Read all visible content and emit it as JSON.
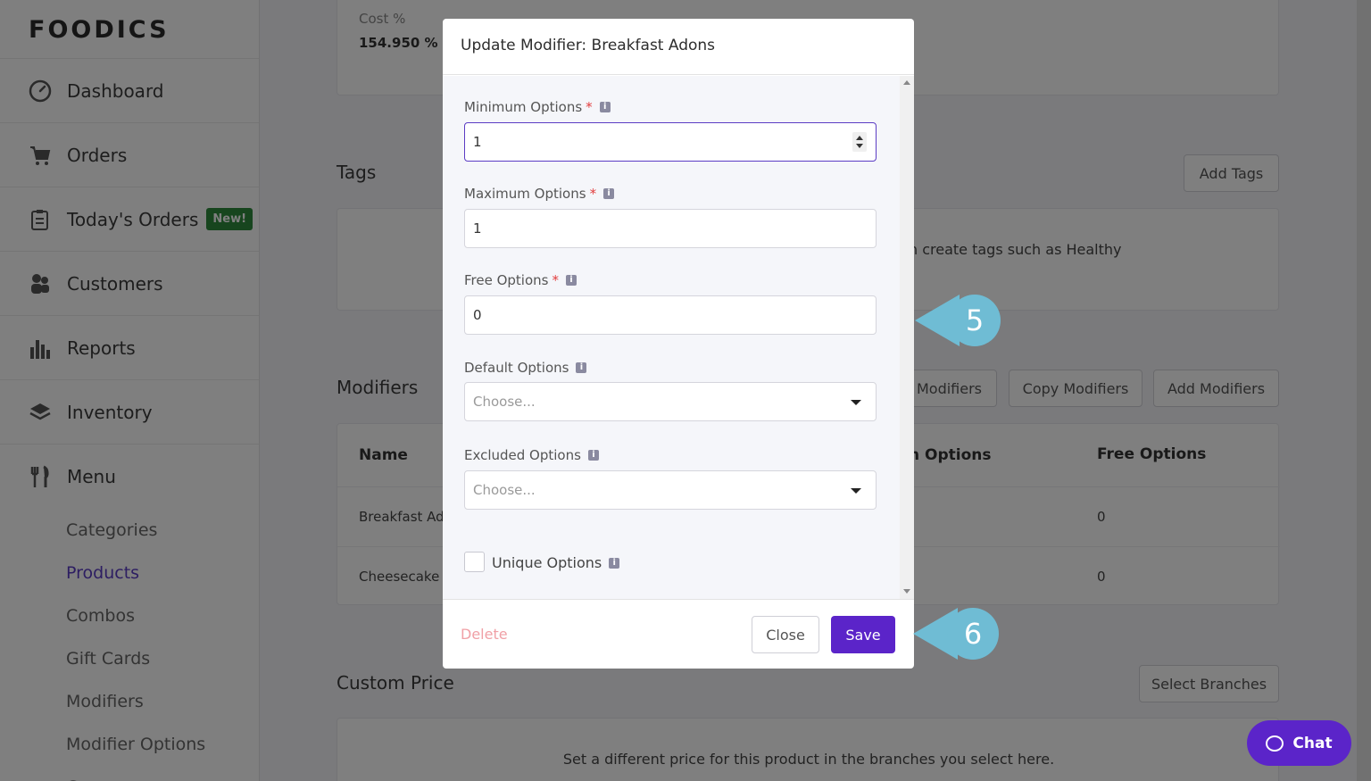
{
  "brand": "FOODICS",
  "nav": [
    {
      "label": "Dashboard",
      "icon": "gauge-icon"
    },
    {
      "label": "Orders",
      "icon": "cart-icon"
    },
    {
      "label": "Today's Orders",
      "icon": "clipboard-icon",
      "badge": "New!"
    },
    {
      "label": "Customers",
      "icon": "customers-icon"
    },
    {
      "label": "Reports",
      "icon": "bar-chart-icon"
    },
    {
      "label": "Inventory",
      "icon": "layers-icon"
    }
  ],
  "menu": {
    "label": "Menu",
    "items": [
      "Categories",
      "Products",
      "Combos",
      "Gift Cards",
      "Modifiers",
      "Modifier Options",
      "Groups"
    ],
    "active": "Products"
  },
  "background": {
    "cost_label": "Cost %",
    "cost_value": "154.950 %",
    "tags_title": "Tags",
    "add_tags": "Add Tags",
    "tags_hint": "n create tags such as Healthy",
    "modifiers_title": "Modifiers",
    "modifiers_btn_partial": "Modifiers",
    "copy_modifiers": "Copy Modifiers",
    "add_modifiers": "Add Modifiers",
    "table_headers": {
      "name": "Name",
      "max_partial": "n Options",
      "free": "Free Options"
    },
    "rows": [
      {
        "name": "Breakfast Ad",
        "free": "0"
      },
      {
        "name": "Cheesecake",
        "free": "0"
      }
    ],
    "custom_price_title": "Custom Price",
    "select_branches": "Select Branches",
    "custom_price_hint": "Set a different price for this product in the branches you select here."
  },
  "modal": {
    "title": "Update Modifier: Breakfast Adons",
    "fields": {
      "minimum": {
        "label": "Minimum Options",
        "required": "*",
        "value": "1"
      },
      "maximum": {
        "label": "Maximum Options",
        "required": "*",
        "value": "1"
      },
      "free": {
        "label": "Free Options",
        "required": "*",
        "value": "0"
      },
      "default": {
        "label": "Default Options",
        "placeholder": "Choose..."
      },
      "excluded": {
        "label": "Excluded Options",
        "placeholder": "Choose..."
      },
      "unique": {
        "label": "Unique Options"
      }
    },
    "delete": "Delete",
    "close": "Close",
    "save": "Save"
  },
  "callouts": [
    "5",
    "6"
  ],
  "chat": "Chat",
  "colors": {
    "accent": "#5b24c9",
    "callout": "#6fbcd4",
    "badge": "#2e8b3d"
  }
}
